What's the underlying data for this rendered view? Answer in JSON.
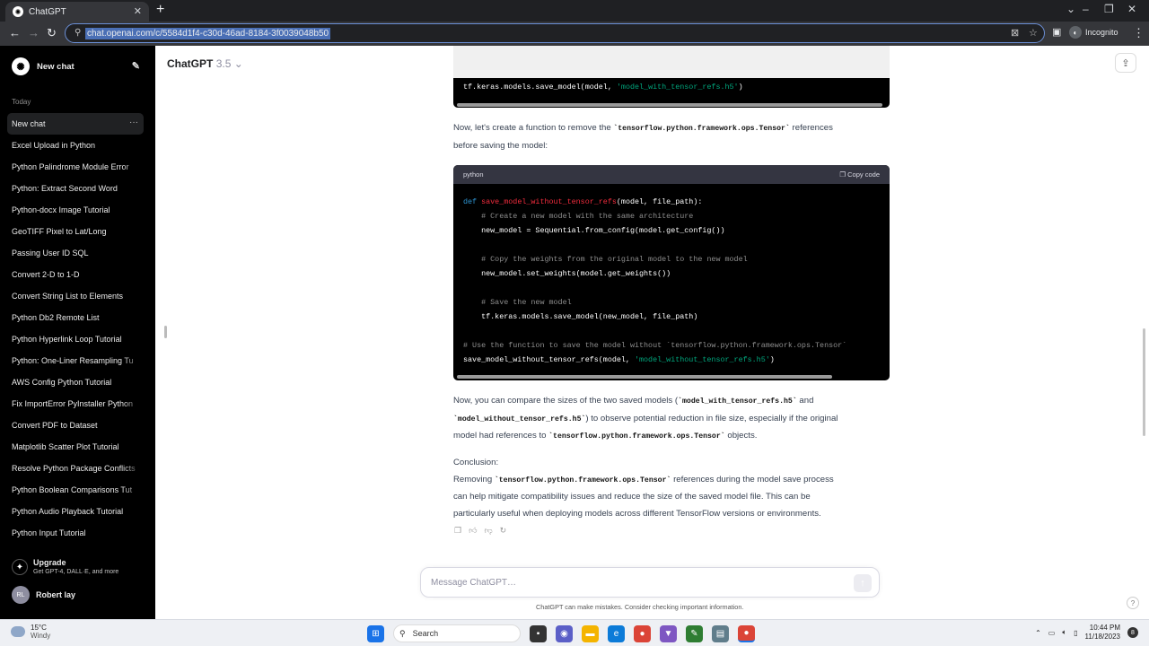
{
  "browser": {
    "tab_title": "ChatGPT",
    "tab_close": "✕",
    "new_tab": "+",
    "url": "chat.openai.com/c/5584d1f4-c30d-46ad-8184-3f0039048b50",
    "profile_label": "Incognito",
    "controls": {
      "minimize": "–",
      "maximize": "❐",
      "close": "✕"
    }
  },
  "sidebar": {
    "new_chat_label": "New chat",
    "section_today": "Today",
    "items": [
      {
        "label": "New chat"
      },
      {
        "label": "Excel Upload in Python"
      },
      {
        "label": "Python Palindrome Module Error"
      },
      {
        "label": "Python: Extract Second Word"
      },
      {
        "label": "Python-docx Image Tutorial"
      },
      {
        "label": "GeoTIFF Pixel to Lat/Long"
      },
      {
        "label": "Passing User ID SQL"
      },
      {
        "label": "Convert 2-D to 1-D"
      },
      {
        "label": "Convert String List to Elements"
      },
      {
        "label": "Python Db2 Remote List"
      },
      {
        "label": "Python Hyperlink Loop Tutorial"
      },
      {
        "label": "Python: One-Liner Resampling Tu"
      },
      {
        "label": "AWS Config Python Tutorial"
      },
      {
        "label": "Fix ImportError PyInstaller Python"
      },
      {
        "label": "Convert PDF to Dataset"
      },
      {
        "label": "Matplotlib Scatter Plot Tutorial"
      },
      {
        "label": "Resolve Python Package Conflicts"
      },
      {
        "label": "Python Boolean Comparisons Tut"
      },
      {
        "label": "Python Audio Playback Tutorial"
      },
      {
        "label": "Python Input Tutorial"
      }
    ],
    "upgrade_title": "Upgrade",
    "upgrade_sub": "Get GPT-4, DALL·E, and more",
    "user_initials": "RL",
    "user_name": "Robert lay"
  },
  "header": {
    "model_name": "ChatGPT",
    "model_version": "3.5",
    "chevron": "⌄"
  },
  "chat": {
    "top_code": {
      "p1": "tf.keras.models.save_model(model, ",
      "p2": "'model_with_tensor_refs.h5'",
      "p3": ")"
    },
    "para1_a": "Now, let's create a function to remove the ",
    "para1_code": "`tensorflow.python.framework.ops.Tensor`",
    "para1_b": " references",
    "para1_c": "before saving the model:",
    "code_lang": "python",
    "copy_label": "Copy code",
    "code": {
      "l1_kw": "def ",
      "l1_fn": "save_model_without_tensor_refs",
      "l1_rest": "(model, file_path):",
      "l2": "    # Create a new model with the same architecture",
      "l3": "    new_model = Sequential.from_config(model.get_config())",
      "l5": "    # Copy the weights from the original model to the new model",
      "l6": "    new_model.set_weights(model.get_weights())",
      "l8": "    # Save the new model",
      "l9": "    tf.keras.models.save_model(new_model, file_path)",
      "l11": "# Use the function to save the model without `tensorflow.python.framework.ops.Tensor`",
      "l12_a": "save_model_without_tensor_refs(model, ",
      "l12_str": "'model_without_tensor_refs.h5'",
      "l12_b": ")"
    },
    "para2_a": "Now, you can compare the sizes of the two saved models (",
    "para2_c1": "`model_with_tensor_refs.h5`",
    "para2_b": " and",
    "para2_c2": "`model_without_tensor_refs.h5`",
    "para2_c": ") to observe potential reduction in file size, especially if the original",
    "para2_d": "model had references to ",
    "para2_c3": "`tensorflow.python.framework.ops.Tensor`",
    "para2_e": " objects.",
    "conclusion": "Conclusion:",
    "para3_a": "Removing ",
    "para3_code": "`tensorflow.python.framework.ops.Tensor`",
    "para3_b": " references during the model save process",
    "para3_c": "can help mitigate compatibility issues and reduce the size of the saved model file. This can be",
    "para3_d": "particularly useful when deploying models across different TensorFlow versions or environments."
  },
  "composer": {
    "placeholder": "Message ChatGPT…",
    "disclaimer": "ChatGPT can make mistakes. Consider checking important information.",
    "help": "?"
  },
  "taskbar": {
    "temp": "15°C",
    "weather": "Windy",
    "search_label": "Search",
    "time": "10:44 PM",
    "date": "11/18/2023",
    "notif_count": "8"
  }
}
